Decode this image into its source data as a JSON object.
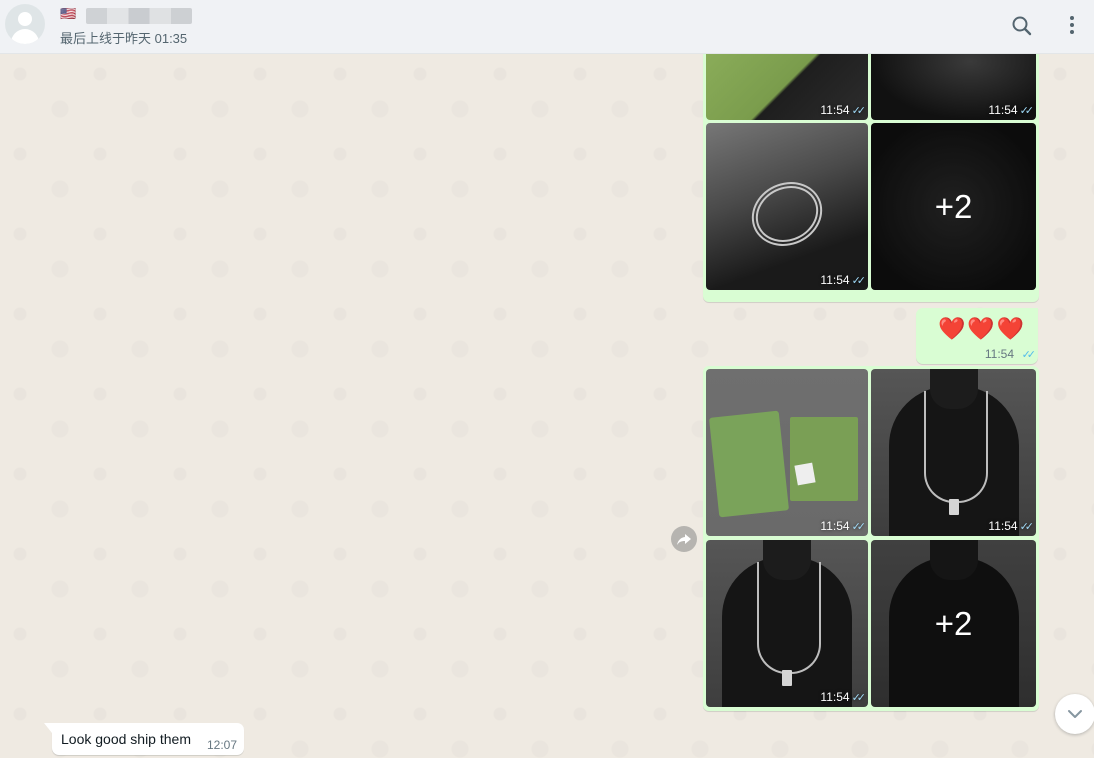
{
  "header": {
    "flag": "🇺🇸",
    "last_seen": "最后上线于昨天 01:35"
  },
  "album1": {
    "tiles": [
      {
        "time": "11:54"
      },
      {
        "time": "11:54"
      },
      {
        "time": "11:54"
      },
      {
        "more": "+2"
      }
    ]
  },
  "hearts_message": {
    "text": "❤️❤️❤️",
    "time": "11:54"
  },
  "album2": {
    "tiles": [
      {
        "time": "11:54"
      },
      {
        "time": "11:54"
      },
      {
        "time": "11:54"
      },
      {
        "more": "+2"
      }
    ]
  },
  "incoming_message": {
    "text": "Look good ship them",
    "time": "12:07"
  },
  "ticks": "✓✓",
  "colors": {
    "outgoing_bubble": "#d9fdd3",
    "read_ticks": "#53bdeb",
    "chat_background": "#efeae2",
    "header_background": "#f0f2f5"
  }
}
